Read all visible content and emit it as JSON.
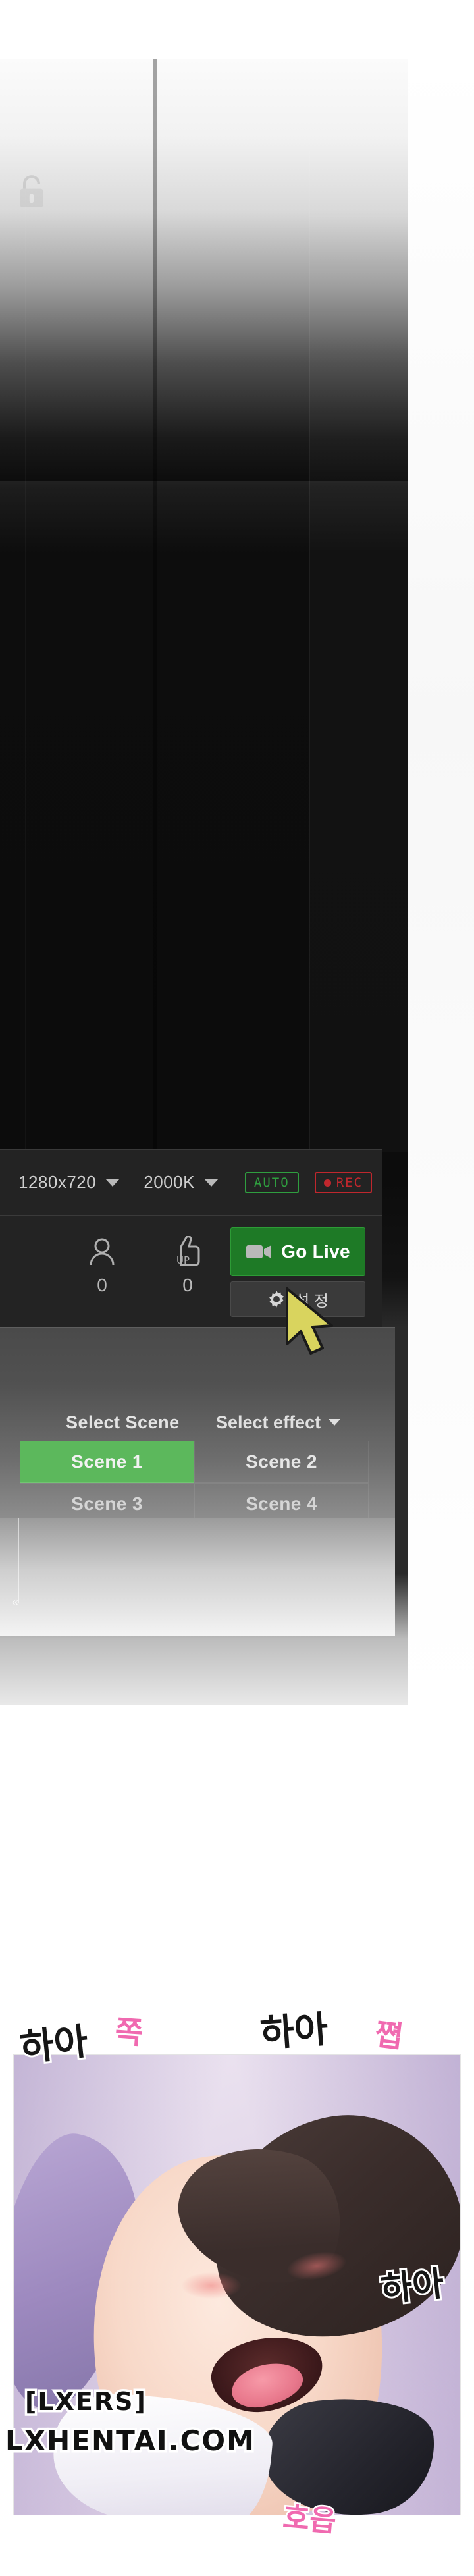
{
  "stream_ui": {
    "lock_icon": "unlocked-padlock-icon",
    "toolbar": {
      "resolution": "1280x720",
      "bitrate": "2000K",
      "auto_badge": "AUTO",
      "rec_badge": "REC"
    },
    "stats": {
      "viewers_icon": "person-icon",
      "viewers_count": "0",
      "likes_icon": "thumbs-up-icon",
      "likes_count": "0"
    },
    "golive_button": {
      "label": "Go Live",
      "icon": "video-camera-icon",
      "color": "#1e7a26"
    },
    "settings_button": {
      "label": "설 정",
      "icon": "gear-icon"
    },
    "scene_picker": {
      "scene_label": "Select Scene",
      "effect_label": "Select effect",
      "scenes": [
        {
          "label": "Scene 1",
          "selected": true
        },
        {
          "label": "Scene 2",
          "selected": false
        },
        {
          "label": "Scene 3",
          "selected": false
        },
        {
          "label": "Scene 4",
          "selected": false
        }
      ],
      "active_color": "#5cb85c"
    },
    "rail_tick": "«"
  },
  "art_panel": {
    "sfx": [
      {
        "text": "하아",
        "style": "black"
      },
      {
        "text": "쪽",
        "style": "pink"
      },
      {
        "text": "하아",
        "style": "black"
      },
      {
        "text": "쪕",
        "style": "pink"
      },
      {
        "text": "하아",
        "style": "black"
      },
      {
        "text": "호읍",
        "style": "pink"
      }
    ]
  },
  "watermark": {
    "line1": "[LXERS]",
    "line2": "LXHENTAI.COM"
  }
}
